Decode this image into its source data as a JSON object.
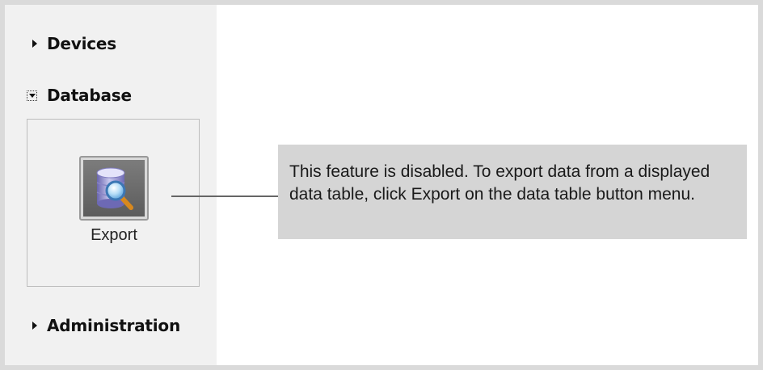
{
  "sidebar": {
    "devices": {
      "label": "Devices",
      "state": "collapsed"
    },
    "database": {
      "label": "Database",
      "state": "expanded",
      "items": [
        {
          "label": "Export",
          "icon": "database-search-icon"
        }
      ]
    },
    "administration": {
      "label": "Administration",
      "state": "collapsed"
    }
  },
  "callout": {
    "text": "This feature is disabled. To export data from a displayed data table, click Export on the data table button menu."
  },
  "colors": {
    "background": "#dadada",
    "sidebar": "#f1f1f1",
    "callout": "#d5d5d5",
    "icon_tile": "#6a6a6a"
  }
}
